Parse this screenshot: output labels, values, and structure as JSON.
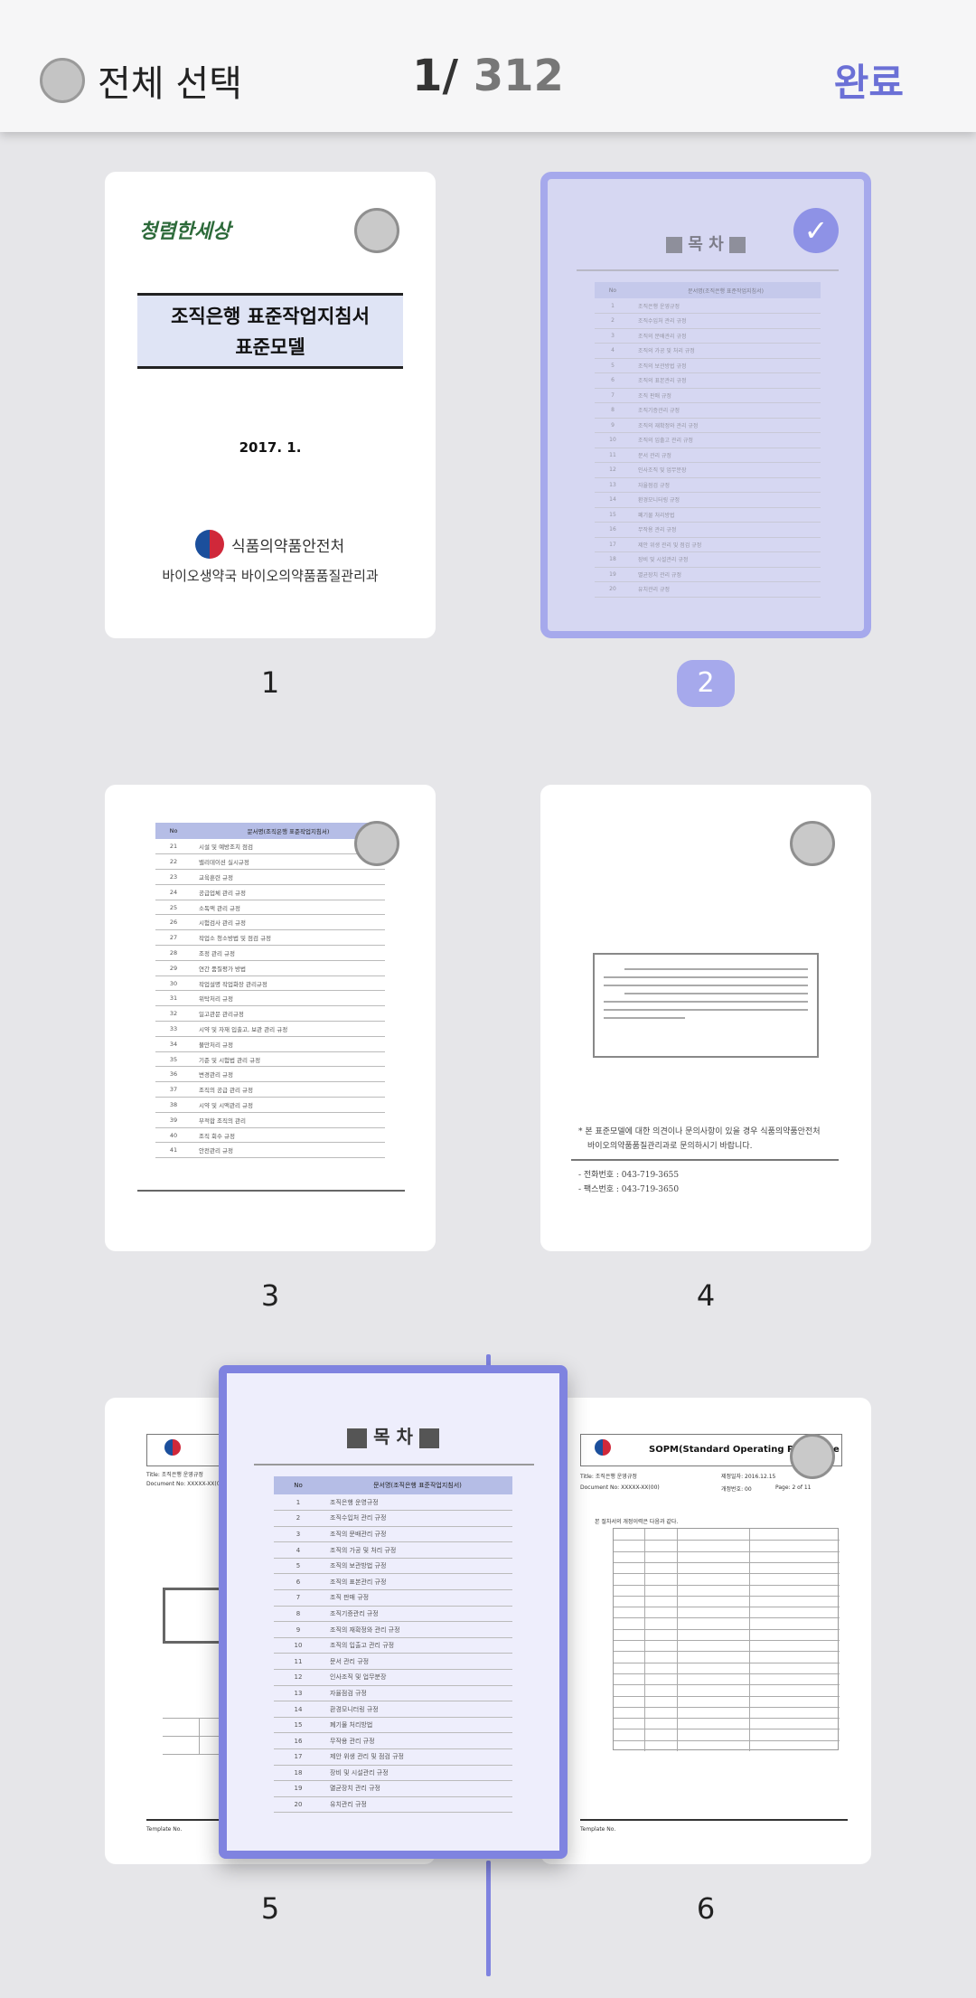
{
  "header": {
    "select_all_label": "전체 선택",
    "page_current": "1",
    "page_separator": "/",
    "page_total": "312",
    "done_label": "완료"
  },
  "pages": [
    {
      "number": "1",
      "selected": false
    },
    {
      "number": "2",
      "selected": true
    },
    {
      "number": "3",
      "selected": false
    },
    {
      "number": "4",
      "selected": false
    },
    {
      "number": "5",
      "selected": false
    },
    {
      "number": "6",
      "selected": false
    }
  ],
  "page1": {
    "logo": "청렴한세상",
    "title_line1": "조직은행 표준작업지침서",
    "title_line2": "표준모델",
    "date": "2017. 1.",
    "agency": "식품의약품안전처",
    "department": "바이오생약국 바이오의약품품질관리과"
  },
  "toc": {
    "title": "목 차",
    "col_no": "No",
    "col_doc": "문서명(조직은행 표준작업지침서)",
    "rows": [
      {
        "no": "1",
        "title": "조직은행 운영규정"
      },
      {
        "no": "2",
        "title": "조직수입처 관리 규정"
      },
      {
        "no": "3",
        "title": "조직의 문배관리 규정"
      },
      {
        "no": "4",
        "title": "조직의 가공 및 처리 규정"
      },
      {
        "no": "5",
        "title": "조직의 보관방법 규정"
      },
      {
        "no": "6",
        "title": "조직의 표본관리 규정"
      },
      {
        "no": "7",
        "title": "조직 판매 규정"
      },
      {
        "no": "8",
        "title": "조직기증관리 규정"
      },
      {
        "no": "9",
        "title": "조직의 재확정와 관리 규정"
      },
      {
        "no": "10",
        "title": "조직의 입출고 관리 규정"
      },
      {
        "no": "11",
        "title": "문서 관리 규정"
      },
      {
        "no": "12",
        "title": "인사조직 및 업무분장"
      },
      {
        "no": "13",
        "title": "자율점검 규정"
      },
      {
        "no": "14",
        "title": "환경모니터링 규정"
      },
      {
        "no": "15",
        "title": "폐기물 처리방법"
      },
      {
        "no": "16",
        "title": "무작용 관리 규정"
      },
      {
        "no": "17",
        "title": "제안 위생 관리 및 점검 규정"
      },
      {
        "no": "18",
        "title": "장비 및 시설관리 규정"
      },
      {
        "no": "19",
        "title": "멸균장치 관리 규정"
      },
      {
        "no": "20",
        "title": "유치관리 규정"
      }
    ]
  },
  "page3": {
    "col_no": "No",
    "col_doc": "문서명(조직은행 표준작업지침서)",
    "rows": [
      {
        "no": "21",
        "title": "시설 및 예방조치 점검"
      },
      {
        "no": "22",
        "title": "밸리데이션 실시규정"
      },
      {
        "no": "23",
        "title": "교육훈련 규정"
      },
      {
        "no": "24",
        "title": "공급업체 관리 규정"
      },
      {
        "no": "25",
        "title": "소독액 관리 규정"
      },
      {
        "no": "26",
        "title": "시험검사 관리 규정"
      },
      {
        "no": "27",
        "title": "작업소 청소방법 및 점검 규정"
      },
      {
        "no": "28",
        "title": "조정 관리 규정"
      },
      {
        "no": "29",
        "title": "연간 품질평가 방법"
      },
      {
        "no": "30",
        "title": "작업설명 작업화장 관리규정"
      },
      {
        "no": "31",
        "title": "위탁처리 규정"
      },
      {
        "no": "32",
        "title": "일고관문 관리규정"
      },
      {
        "no": "33",
        "title": "시약 및 자재 입출고, 보관 관리 규정"
      },
      {
        "no": "34",
        "title": "불만처리 규정"
      },
      {
        "no": "35",
        "title": "기준 및 시험법 관리 규정"
      },
      {
        "no": "36",
        "title": "변경관리 규정"
      },
      {
        "no": "37",
        "title": "조직의 공급 관리 규정"
      },
      {
        "no": "38",
        "title": "시약 및 시액관리 규정"
      },
      {
        "no": "39",
        "title": "부적합 조직의 관리"
      },
      {
        "no": "40",
        "title": "조직 회수 규정"
      },
      {
        "no": "41",
        "title": "안전관리 규정"
      }
    ]
  },
  "page4": {
    "notice_line1": "* 본 표준모델에 대한 의견이나 문의사항이 있을 경우 식품의약품안전처",
    "notice_line2": "바이오의약품품질관리과로 문의하시기 바랍니다.",
    "phone": "- 전화번호 : 043-719-3655",
    "fax": "- 팩스번호 : 043-719-3650"
  },
  "sop": {
    "title": "SOPM(Standard Operating Procedure",
    "title_label": "Title: 조직은행 운영규정",
    "doc_label": "Document No: XXXXX-XX(00)",
    "effective_label": "제정일자: 2016.12.15",
    "revision_label": "개정번호: 00",
    "page_label": "Page: 2 of 11",
    "footer": "Template No.",
    "history_note": "본 절차서의 개정이력은 다음과 같다."
  }
}
